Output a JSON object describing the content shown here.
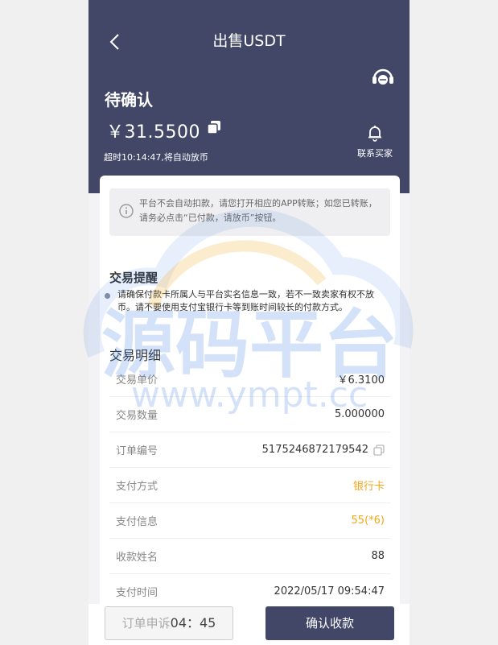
{
  "nav": {
    "title": "出售USDT",
    "back_icon": "back-chevron-icon",
    "service_icon": "customer-service-icon"
  },
  "order": {
    "status": "待确认",
    "amount": "￥31.5500",
    "timeout_text": "超时10:14:47,将自动放币",
    "contact_label": "联系买家"
  },
  "notice": {
    "text": "平台不会自动扣款，请您打开相应的APP转账；如您已转账，请务必点击“已付款，请放币”按钮。"
  },
  "reminder": {
    "title": "交易提醒",
    "text": "请确保付款卡所属人与平台实名信息一致，若不一致卖家有权不放币。请不要使用支付宝银行卡等到账时间较长的付款方式。"
  },
  "details": {
    "title": "交易明细",
    "rows": [
      {
        "label": "交易单价",
        "value": "￥6.3100"
      },
      {
        "label": "交易数量",
        "value": "5.000000"
      },
      {
        "label": "订单编号",
        "value": "5175246872179542"
      },
      {
        "label": "支付方式",
        "value": "银行卡"
      },
      {
        "label": "支付信息",
        "value": "55(*6)"
      },
      {
        "label": "收款姓名",
        "value": "88"
      },
      {
        "label": "支付时间",
        "value": "2022/05/17 09:54:47"
      }
    ]
  },
  "actions": {
    "appeal_label": "订单申诉",
    "appeal_countdown": "04：45",
    "confirm_label": "确认收款"
  },
  "watermark": {
    "cn": "源码平台",
    "url": "www.ympt.cc"
  },
  "colors": {
    "header": "#424767",
    "accent_orange": "#f3a71b",
    "watermark": "#3b7be6"
  }
}
